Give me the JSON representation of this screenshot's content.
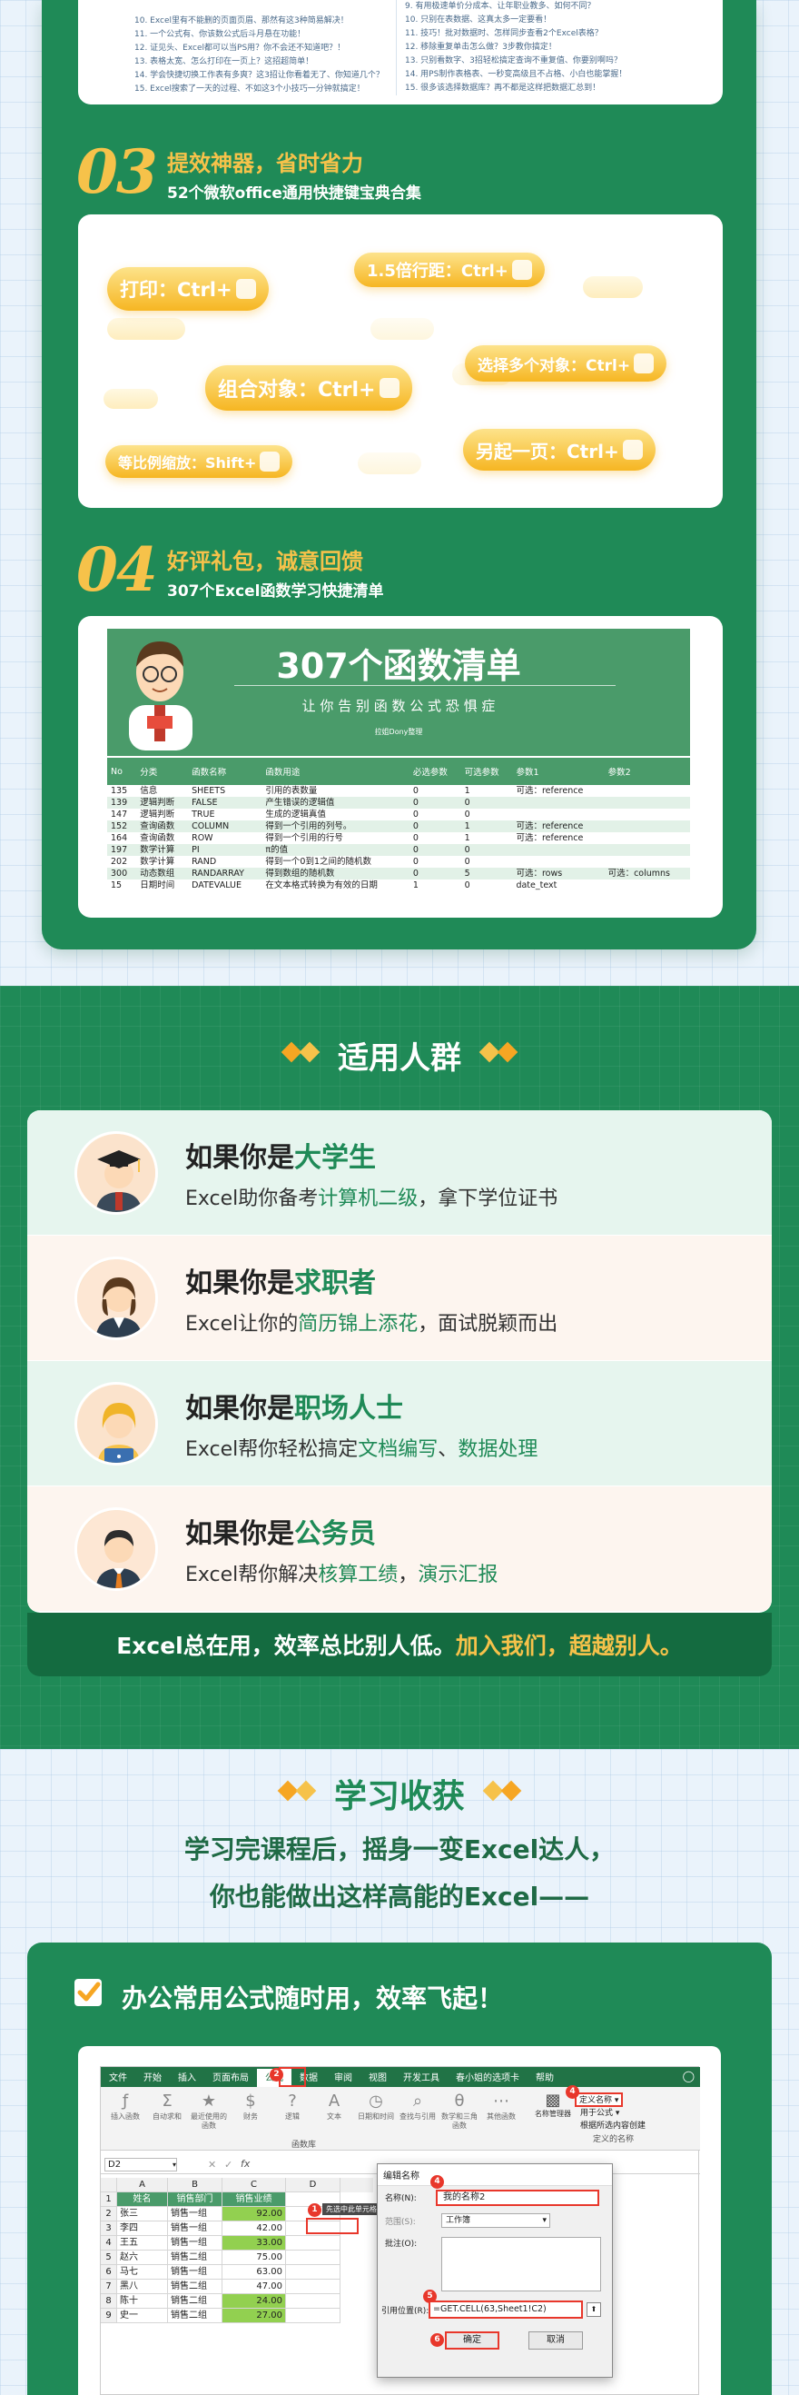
{
  "top_list": {
    "left": [
      "10. Excel里有不能删的页面页眉、那然有这3种简易解决！",
      "11. 一个公式有、你该数公式后斗月悬在功能！",
      "12. 证见头、Excel都可以当PS用？你不会还不知道吧？！",
      "13. 表格太宽、怎么打印在一页上？这招超简单！",
      "14. 学会快捷切换工作表有多爽？这3招让你看着无了、你知道几个？",
      "15. Excel搜索了一天的过程、不如这3个小技巧一分钟就搞定！"
    ],
    "right": [
      "9. 有用极速单价分成本、让年职业教多、如何不同？",
      "10. 只别在表数据、这真太多一定要看！",
      "11. 技巧！批对数据时、怎样同步查看2个Excel表格？",
      "12. 移除重复单击怎么做？3步教你搞定！",
      "13. 只别看数字、3招轻松搞定查询不重复值、你要别啊吗？",
      "14. 用PS制作表格表、一秒变高级且不占格、小白也能掌握！",
      "15. 很多该选择数据库？再不都是这样把数据汇总到！"
    ]
  },
  "section03": {
    "num": "03",
    "title": "提效神器，省时省力",
    "subtitle": "52个微软office通用快捷键宝典合集",
    "pills": [
      "打印：Ctrl+",
      "1.5倍行距：Ctrl+",
      "组合对象：Ctrl+",
      "选择多个对象：Ctrl+",
      "等比例缩放：Shift+",
      "另起一页：Ctrl+"
    ]
  },
  "section04": {
    "num": "04",
    "title": "好评礼包，诚意回馈",
    "subtitle": "307个Excel函数学习快捷清单",
    "banner_title": "307个函数清单",
    "banner_slogan": "让 你 告 别 函 数 公 式 恐 惧 症",
    "banner_brand": "拉姐Dony整理",
    "table_headers": [
      "No",
      "分类",
      "函数名称",
      "函数用途",
      "必选参数",
      "可选参数",
      "参数1",
      "参数2"
    ],
    "table_rows": [
      [
        "135",
        "信息",
        "SHEETS",
        "引用的表数量",
        "0",
        "1",
        "可选：reference",
        ""
      ],
      [
        "139",
        "逻辑判断",
        "FALSE",
        "产生错误的逻辑值",
        "0",
        "0",
        "",
        ""
      ],
      [
        "147",
        "逻辑判断",
        "TRUE",
        "生成的逻辑真值",
        "0",
        "0",
        "",
        ""
      ],
      [
        "152",
        "查询函数",
        "COLUMN",
        "得到一个引用的列号。",
        "0",
        "1",
        "可选：reference",
        ""
      ],
      [
        "164",
        "查询函数",
        "ROW",
        "得到一个引用的行号",
        "0",
        "1",
        "可选：reference",
        ""
      ],
      [
        "197",
        "数学计算",
        "PI",
        "π的值",
        "0",
        "0",
        "",
        ""
      ],
      [
        "202",
        "数学计算",
        "RAND",
        "得到一个0到1之间的随机数",
        "0",
        "0",
        "",
        ""
      ],
      [
        "300",
        "动态数组",
        "RANDARRAY",
        "得到数组的随机数",
        "0",
        "5",
        "可选：rows",
        "可选：columns"
      ],
      [
        "15",
        "日期时间",
        "DATEVALUE",
        "在文本格式转换为有效的日期",
        "1",
        "0",
        "date_text",
        ""
      ]
    ]
  },
  "audience": {
    "heading": "适用人群",
    "items": [
      {
        "prefix": "如果你是",
        "role": "大学生",
        "desc_a": "Excel助你备考",
        "desc_hl1": "计算机二级",
        "desc_b": "，拿下学位证书",
        "desc_hl2": "",
        "bg": "#e6f5ee"
      },
      {
        "prefix": "如果你是",
        "role": "求职者",
        "desc_a": "Excel让你的",
        "desc_hl1": "简历锦上添花",
        "desc_b": "，面试脱颖而出",
        "desc_hl2": "",
        "bg": "#fdf5ef"
      },
      {
        "prefix": "如果你是",
        "role": "职场人士",
        "desc_a": "Excel帮你轻松搞定",
        "desc_hl1": "文档编写",
        "desc_b": "、",
        "desc_hl2": "数据处理",
        "bg": "#e6f5ee"
      },
      {
        "prefix": "如果你是",
        "role": "公务员",
        "desc_a": "Excel帮你解决",
        "desc_hl1": "核算工绩",
        "desc_b": "，",
        "desc_hl2": "演示汇报",
        "bg": "#fdf5ef"
      }
    ],
    "footer_white": "Excel总在用，效率总比别人低。",
    "footer_yellow": "加入我们，超越别人。"
  },
  "gains": {
    "heading": "学习收获",
    "line1": "学习完课程后，摇身一变Excel达人，",
    "line2": "你也能做出这样高能的Excel——",
    "card_title": "办公常用公式随时用，效率飞起！"
  },
  "excel": {
    "tabs": [
      "文件",
      "开始",
      "插入",
      "页面布局",
      "公式",
      "数据",
      "审阅",
      "视图",
      "开发工具",
      "春小姐的选项卡",
      "帮助"
    ],
    "active_tab": "公式",
    "ribbon_buttons": [
      "插入函数",
      "自动求和",
      "最近使用的函数",
      "财务",
      "逻辑",
      "文本",
      "日期和时间",
      "查找与引用",
      "数学和三角函数",
      "其他函数"
    ],
    "group_label": "函数库",
    "name_manager": "名称管理器",
    "define_name_items": [
      "定义名称",
      "用于公式",
      "根据所选内容创建"
    ],
    "defined_names_label": "定义的名称",
    "name_box": "D2",
    "fx": "fx",
    "col_headers": [
      "A",
      "B",
      "C",
      "D"
    ],
    "header_row": [
      "姓名",
      "销售部门",
      "销售业绩"
    ],
    "rows": [
      [
        "张三",
        "销售一组",
        "92.00"
      ],
      [
        "李四",
        "销售一组",
        "42.00"
      ],
      [
        "王五",
        "销售一组",
        "33.00"
      ],
      [
        "赵六",
        "销售二组",
        "75.00"
      ],
      [
        "马七",
        "销售一组",
        "63.00"
      ],
      [
        "黑八",
        "销售二组",
        "47.00"
      ],
      [
        "陈十",
        "销售二组",
        "24.00"
      ],
      [
        "史一",
        "销售二组",
        "27.00"
      ]
    ],
    "tooltip": "先选中此单元格",
    "dialog_title": "编辑名称",
    "name_label": "名称(N):",
    "name_value": "我的名称2",
    "scope_label": "范围(S):",
    "scope_value": "工作簿",
    "comment_label": "批注(O):",
    "ref_label": "引用位置(R):",
    "ref_value": "=GET.CELL(63,Sheet1!C2)",
    "ok": "确定",
    "cancel": "取消",
    "markers": [
      "1",
      "2",
      "3",
      "4",
      "5",
      "6"
    ]
  }
}
